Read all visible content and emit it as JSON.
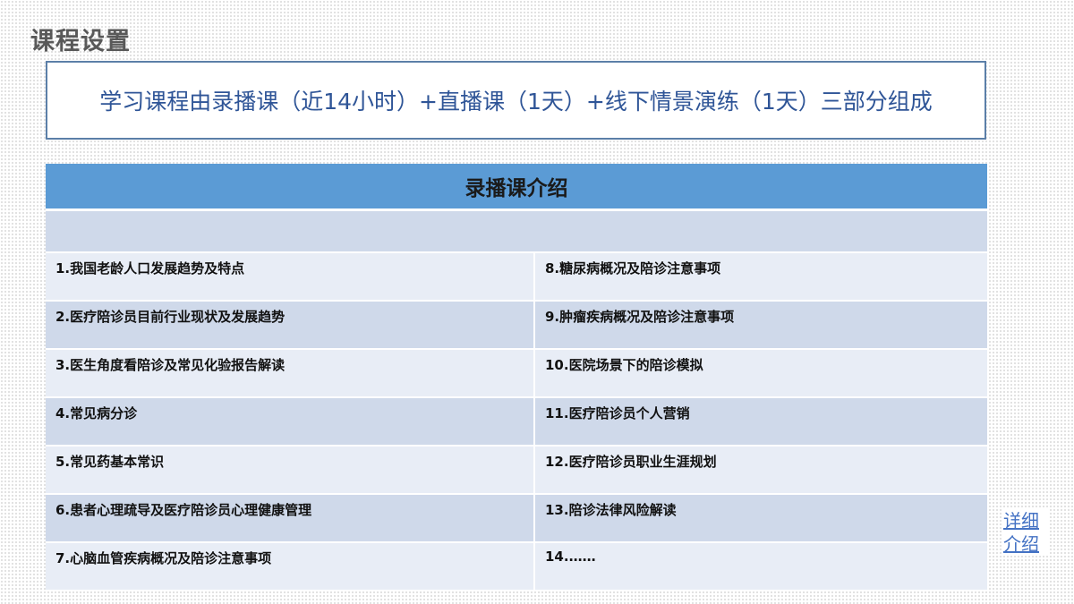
{
  "page": {
    "title": "课程设置",
    "summary": "学习课程由录播课（近14小时）+直播课（1天）+线下情景演练（1天）三部分组成"
  },
  "table": {
    "header": "录播课介绍",
    "rows": [
      {
        "left": "1.我国老龄人口发展趋势及特点",
        "right": "8.糖尿病概况及陪诊注意事项"
      },
      {
        "left": "2.医疗陪诊员目前行业现状及发展趋势",
        "right": "9.肿瘤疾病概况及陪诊注意事项"
      },
      {
        "left": "3.医生角度看陪诊及常见化验报告解读",
        "right": "10.医院场景下的陪诊模拟"
      },
      {
        "left": "4.常见病分诊",
        "right": "11.医疗陪诊员个人营销"
      },
      {
        "left": "5.常见药基本常识",
        "right": "12.医疗陪诊员职业生涯规划"
      },
      {
        "left": "6.患者心理疏导及医疗陪诊员心理健康管理",
        "right": "13.陪诊法律风险解读"
      },
      {
        "left": "7.心脑血管疾病概况及陪诊注意事项",
        "right": "14.……"
      }
    ]
  },
  "detail_link": {
    "label": "详细介绍"
  },
  "colors": {
    "header_bg": "#5b9bd5",
    "row_light": "#e8edf6",
    "row_dark": "#cfd9ea",
    "summary_text": "#2f5597",
    "summary_border": "#5b7fa8",
    "link": "#4472c4"
  }
}
